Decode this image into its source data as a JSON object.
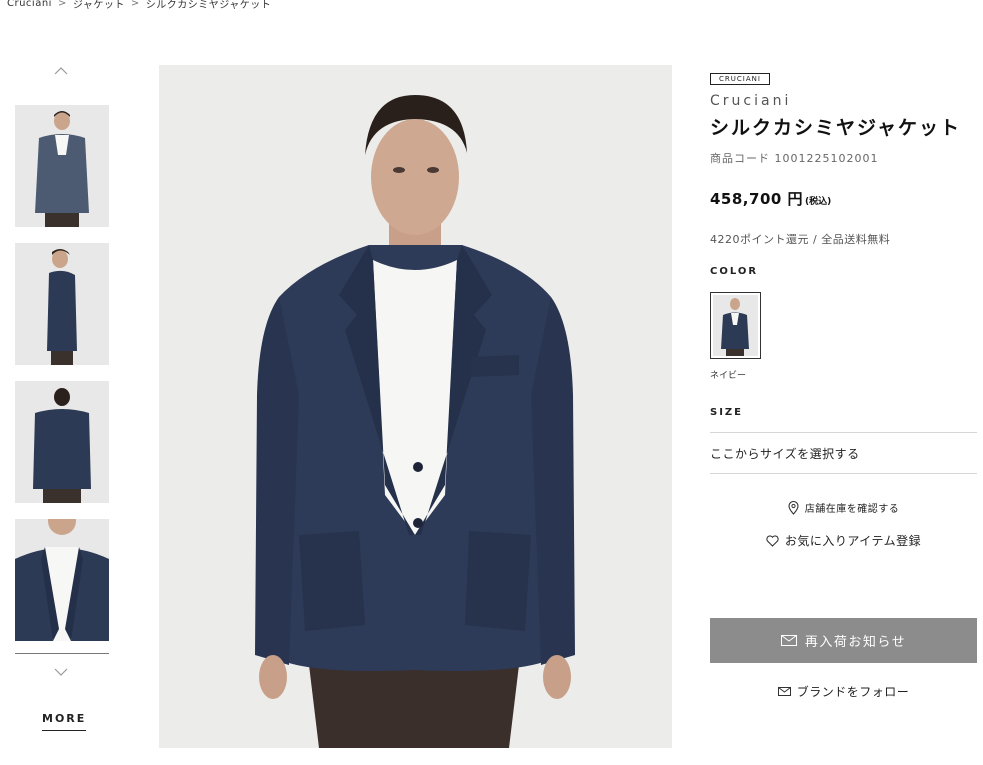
{
  "breadcrumb": [
    "Cruciani",
    "ジャケット",
    "シルクカシミヤジャケット"
  ],
  "breadcrumb_separator": ">",
  "thumbnails": [
    {
      "view": "front"
    },
    {
      "view": "side"
    },
    {
      "view": "back"
    },
    {
      "view": "detail"
    }
  ],
  "more_label": "MORE",
  "product": {
    "brand_badge": "CRUCIANI",
    "brand": "Cruciani",
    "title": "シルクカシミヤジャケット",
    "code": "商品コード 1001225102001",
    "price": "458,700 円",
    "tax_note": "(税込)",
    "points": "4220ポイント還元 / 全品送料無料"
  },
  "color": {
    "label": "COLOR",
    "selected_name": "ネイビー",
    "swatch_hex": "#2c3a55"
  },
  "size": {
    "label": "SIZE",
    "placeholder": "ここからサイズを選択する"
  },
  "actions": {
    "store_stock": "店舗在庫を確認する",
    "favorite": "お気に入りアイテム登録",
    "restock_notify": "再入荷お知らせ",
    "follow_brand": "ブランドをフォロー"
  },
  "colors": {
    "button_bg": "#8c8c8c",
    "jacket": "#2c3a55"
  }
}
